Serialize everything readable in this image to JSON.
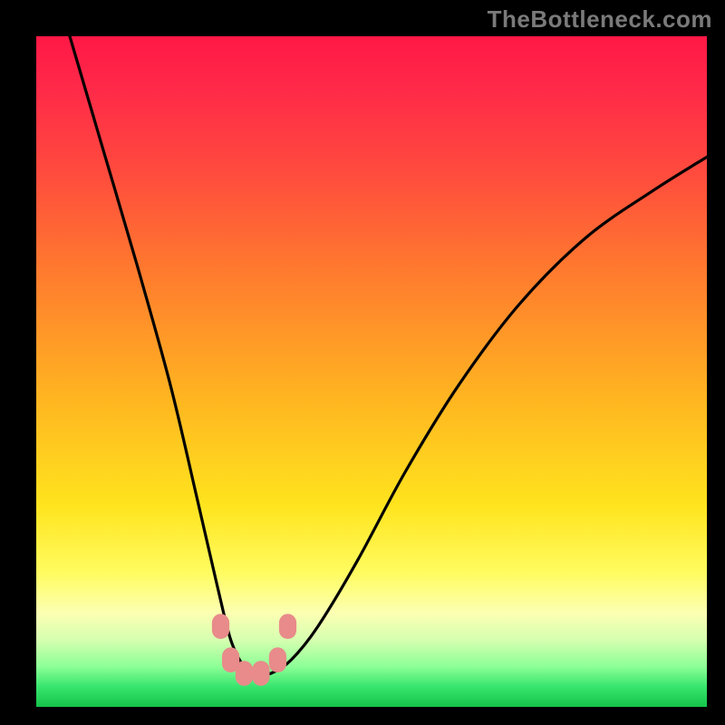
{
  "watermark": "TheBottleneck.com",
  "chart_data": {
    "type": "line",
    "title": "",
    "xlabel": "",
    "ylabel": "",
    "xlim": [
      0,
      100
    ],
    "ylim": [
      0,
      100
    ],
    "grid": false,
    "legend": false,
    "gradient_stops": [
      {
        "pos": 0,
        "color": "#ff1846"
      },
      {
        "pos": 8,
        "color": "#ff2a48"
      },
      {
        "pos": 20,
        "color": "#ff4a3e"
      },
      {
        "pos": 35,
        "color": "#ff7a2e"
      },
      {
        "pos": 55,
        "color": "#ffb820"
      },
      {
        "pos": 70,
        "color": "#ffe41e"
      },
      {
        "pos": 80,
        "color": "#fffc60"
      },
      {
        "pos": 86,
        "color": "#fcffb2"
      },
      {
        "pos": 90,
        "color": "#d6ffb0"
      },
      {
        "pos": 94,
        "color": "#8cff96"
      },
      {
        "pos": 97,
        "color": "#38e56e"
      },
      {
        "pos": 100,
        "color": "#14c44a"
      }
    ],
    "series": [
      {
        "name": "bottleneck-curve",
        "color": "#000000",
        "x": [
          5,
          10,
          15,
          20,
          24,
          27,
          29,
          31,
          33,
          35,
          38,
          42,
          48,
          55,
          63,
          72,
          82,
          92,
          100
        ],
        "y": [
          100,
          83,
          66,
          48,
          31,
          18,
          10,
          6,
          5,
          5,
          7,
          12,
          22,
          35,
          48,
          60,
          70,
          77,
          82
        ]
      }
    ],
    "markers": [
      {
        "x": 27.5,
        "y": 12,
        "color": "#e88b8a",
        "size": 6
      },
      {
        "x": 29,
        "y": 7,
        "color": "#e88b8a",
        "size": 6
      },
      {
        "x": 31,
        "y": 5,
        "color": "#e88b8a",
        "size": 6
      },
      {
        "x": 33.5,
        "y": 5,
        "color": "#e88b8a",
        "size": 6
      },
      {
        "x": 36,
        "y": 7,
        "color": "#e88b8a",
        "size": 6
      },
      {
        "x": 37.5,
        "y": 12,
        "color": "#e88b8a",
        "size": 6
      }
    ]
  }
}
